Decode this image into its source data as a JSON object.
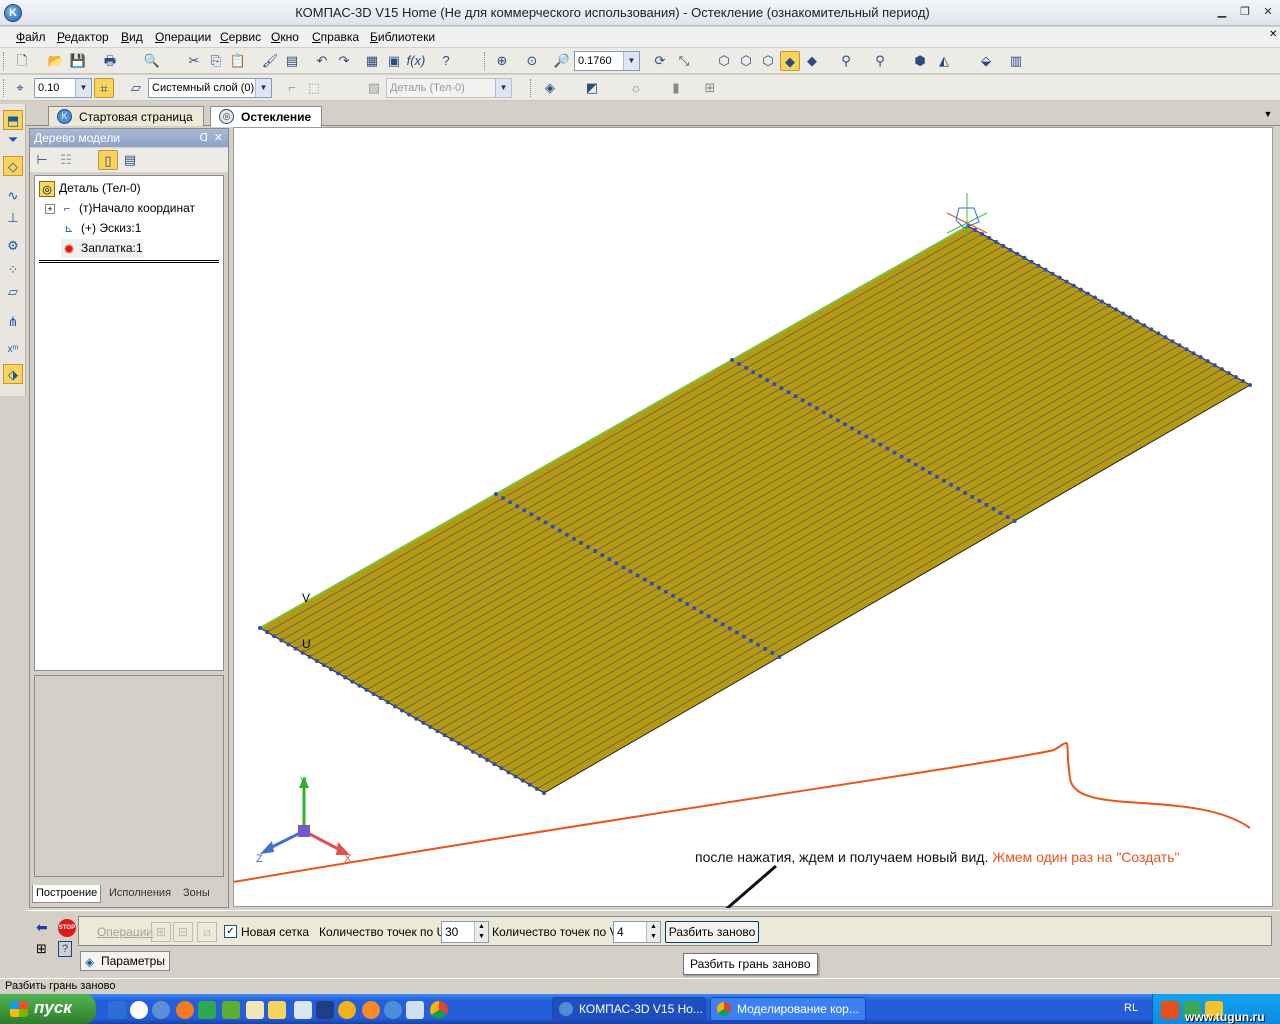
{
  "window": {
    "title": "КОМПАС-3D V15 Home (Не для коммерческого использования) - Остекление (ознакомительный период)",
    "logo_icon": "kompas-logo-icon"
  },
  "menu": [
    "Файл",
    "Редактор",
    "Вид",
    "Операции",
    "Сервис",
    "Окно",
    "Справка",
    "Библиотеки"
  ],
  "toolbar1": {
    "zoom_value": "0.1760"
  },
  "toolbar2": {
    "step_value": "0.10",
    "layer_value": "Системный слой (0)",
    "object_value": "Деталь (Тел-0)"
  },
  "tabs": [
    {
      "label": "Стартовая страница"
    },
    {
      "label": "Остекление"
    }
  ],
  "tree": {
    "header": "Дерево модели",
    "nodes": [
      {
        "label": "Деталь (Тел-0)"
      },
      {
        "label": "(т)Начало координат"
      },
      {
        "label": "(+) Эскиз:1"
      },
      {
        "label": "Заплатка:1"
      }
    ],
    "bottom_tabs": [
      "Построение",
      "Исполнения",
      "Зоны"
    ]
  },
  "viewport": {
    "plate_color": "#b39a12",
    "axis_labels": {
      "x": "X",
      "y": "Y",
      "z": "Z"
    },
    "corner_labels": {
      "v": "V",
      "u": "U"
    },
    "annotation_black": "после нажатия, ждем и получаем новый вид.",
    "annotation_red": "Жмем один раз на \"Создать\""
  },
  "properties": {
    "operations_label": "Операции",
    "new_grid_label": "Новая сетка",
    "new_grid_checked": true,
    "u_count_label": "Количество точек по U",
    "u_count_value": "30",
    "v_count_label": "Количество точек по V",
    "v_count_value": "4",
    "rebuild_button": "Разбить заново",
    "params_tab": "Параметры",
    "tooltip": "Разбить грань заново"
  },
  "status": {
    "text": "Разбить грань заново"
  },
  "taskbar": {
    "start_label": "пуск",
    "tasks": [
      {
        "label": "КОМПАС-3D V15 Ho..."
      },
      {
        "label": "Моделирование кор..."
      }
    ],
    "lang": "RL",
    "watermark": "www.tugun.ru"
  }
}
